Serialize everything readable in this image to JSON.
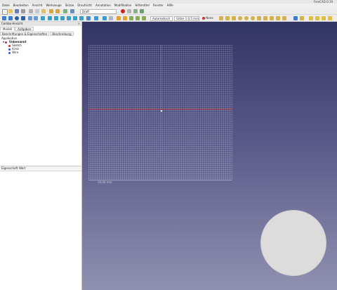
{
  "window": {
    "title": "FreeCAD 0.19"
  },
  "menu": [
    "Datei",
    "Bearbeiten",
    "Ansicht",
    "Werkzeuge",
    "Skizze",
    "Draufsicht",
    "Annotation",
    "Modifikation",
    "Hilfsmittel",
    "Fenster",
    "Hilfe"
  ],
  "toolbar": {
    "workbench": "Draft",
    "snap_mode": "Automatisch",
    "snap_size": "Gitter 1 0,5 mm",
    "draw_style": "None"
  },
  "combo_view": {
    "title": "Combo-Ansicht",
    "tabs": [
      "Modell",
      "Aufgaben"
    ],
    "subtabs": [
      "Beschriftungen & Eigenschaften",
      "Beschreibung"
    ],
    "tree_root": "Applikation",
    "tree": [
      {
        "label": "Unbenannt",
        "color": "#c0303a"
      },
      {
        "label": "Sketch",
        "color": "#c03030"
      },
      {
        "label": "Kreis",
        "color": "#3050c0"
      },
      {
        "label": "Wire",
        "color": "#3050c0"
      }
    ],
    "property_col": "Eigenschaft",
    "value_col": "Wert"
  },
  "view": {
    "ruler_label": "10,00 mm"
  },
  "colors": {
    "x_axis": "#c03a3a",
    "y_axis": "#3a9a3a"
  }
}
